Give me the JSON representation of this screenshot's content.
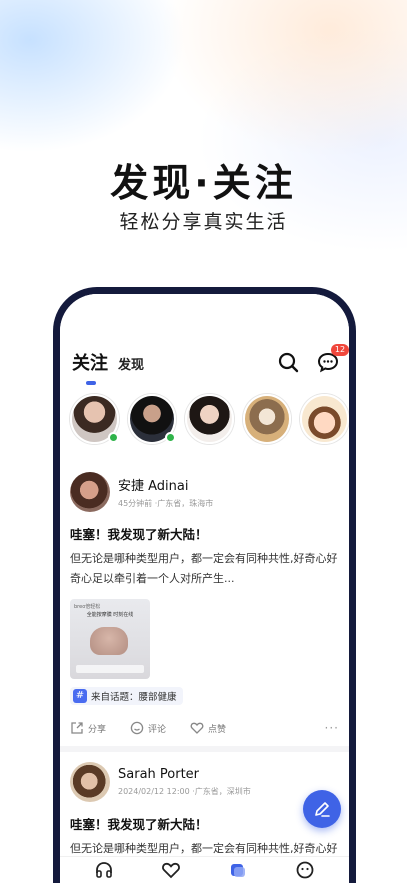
{
  "hero": {
    "title": "发现·关注",
    "subtitle": "轻松分享真实生活"
  },
  "app": {
    "tabs": [
      {
        "label": "关注",
        "active": true
      },
      {
        "label": "发现",
        "active": false
      }
    ],
    "icons": {
      "search": "search-icon",
      "messages": "chat-bubble-icon"
    },
    "message_badge": "12",
    "stories": [
      {
        "name": "story-1",
        "online": true
      },
      {
        "name": "story-2",
        "online": true
      },
      {
        "name": "story-3",
        "online": false
      },
      {
        "name": "story-4",
        "online": false
      },
      {
        "name": "story-5",
        "online": false
      }
    ],
    "posts": [
      {
        "author": "安捷 Adinai",
        "meta": "45分钟前 ·广东省，珠海市",
        "title": "哇塞！我发现了新大陆！",
        "body": "但无论是哪种类型用户，都一定会有同种共性,好奇心好奇心足以牵引着一个人对所产生...",
        "image": {
          "brand": "breo倍轻松",
          "headline": "全能按摩膜 时刻在线"
        },
        "topic": "来自话题：腰部健康",
        "actions": {
          "share": "分享",
          "comment": "评论",
          "like": "点赞"
        }
      },
      {
        "author": "Sarah Porter",
        "meta": "2024/02/12 12:00 ·广东省，深圳市",
        "title": "哇塞！我发现了新大陆！",
        "body": "但无论是哪种类型用户，都一定会有同种共性,好奇心好奇心足以牵引着一个人对所产生..."
      }
    ],
    "colors": {
      "accent": "#3f63e6",
      "online": "#2fb34a",
      "badge": "#f0473c",
      "phone_frame": "#141a3c"
    }
  }
}
